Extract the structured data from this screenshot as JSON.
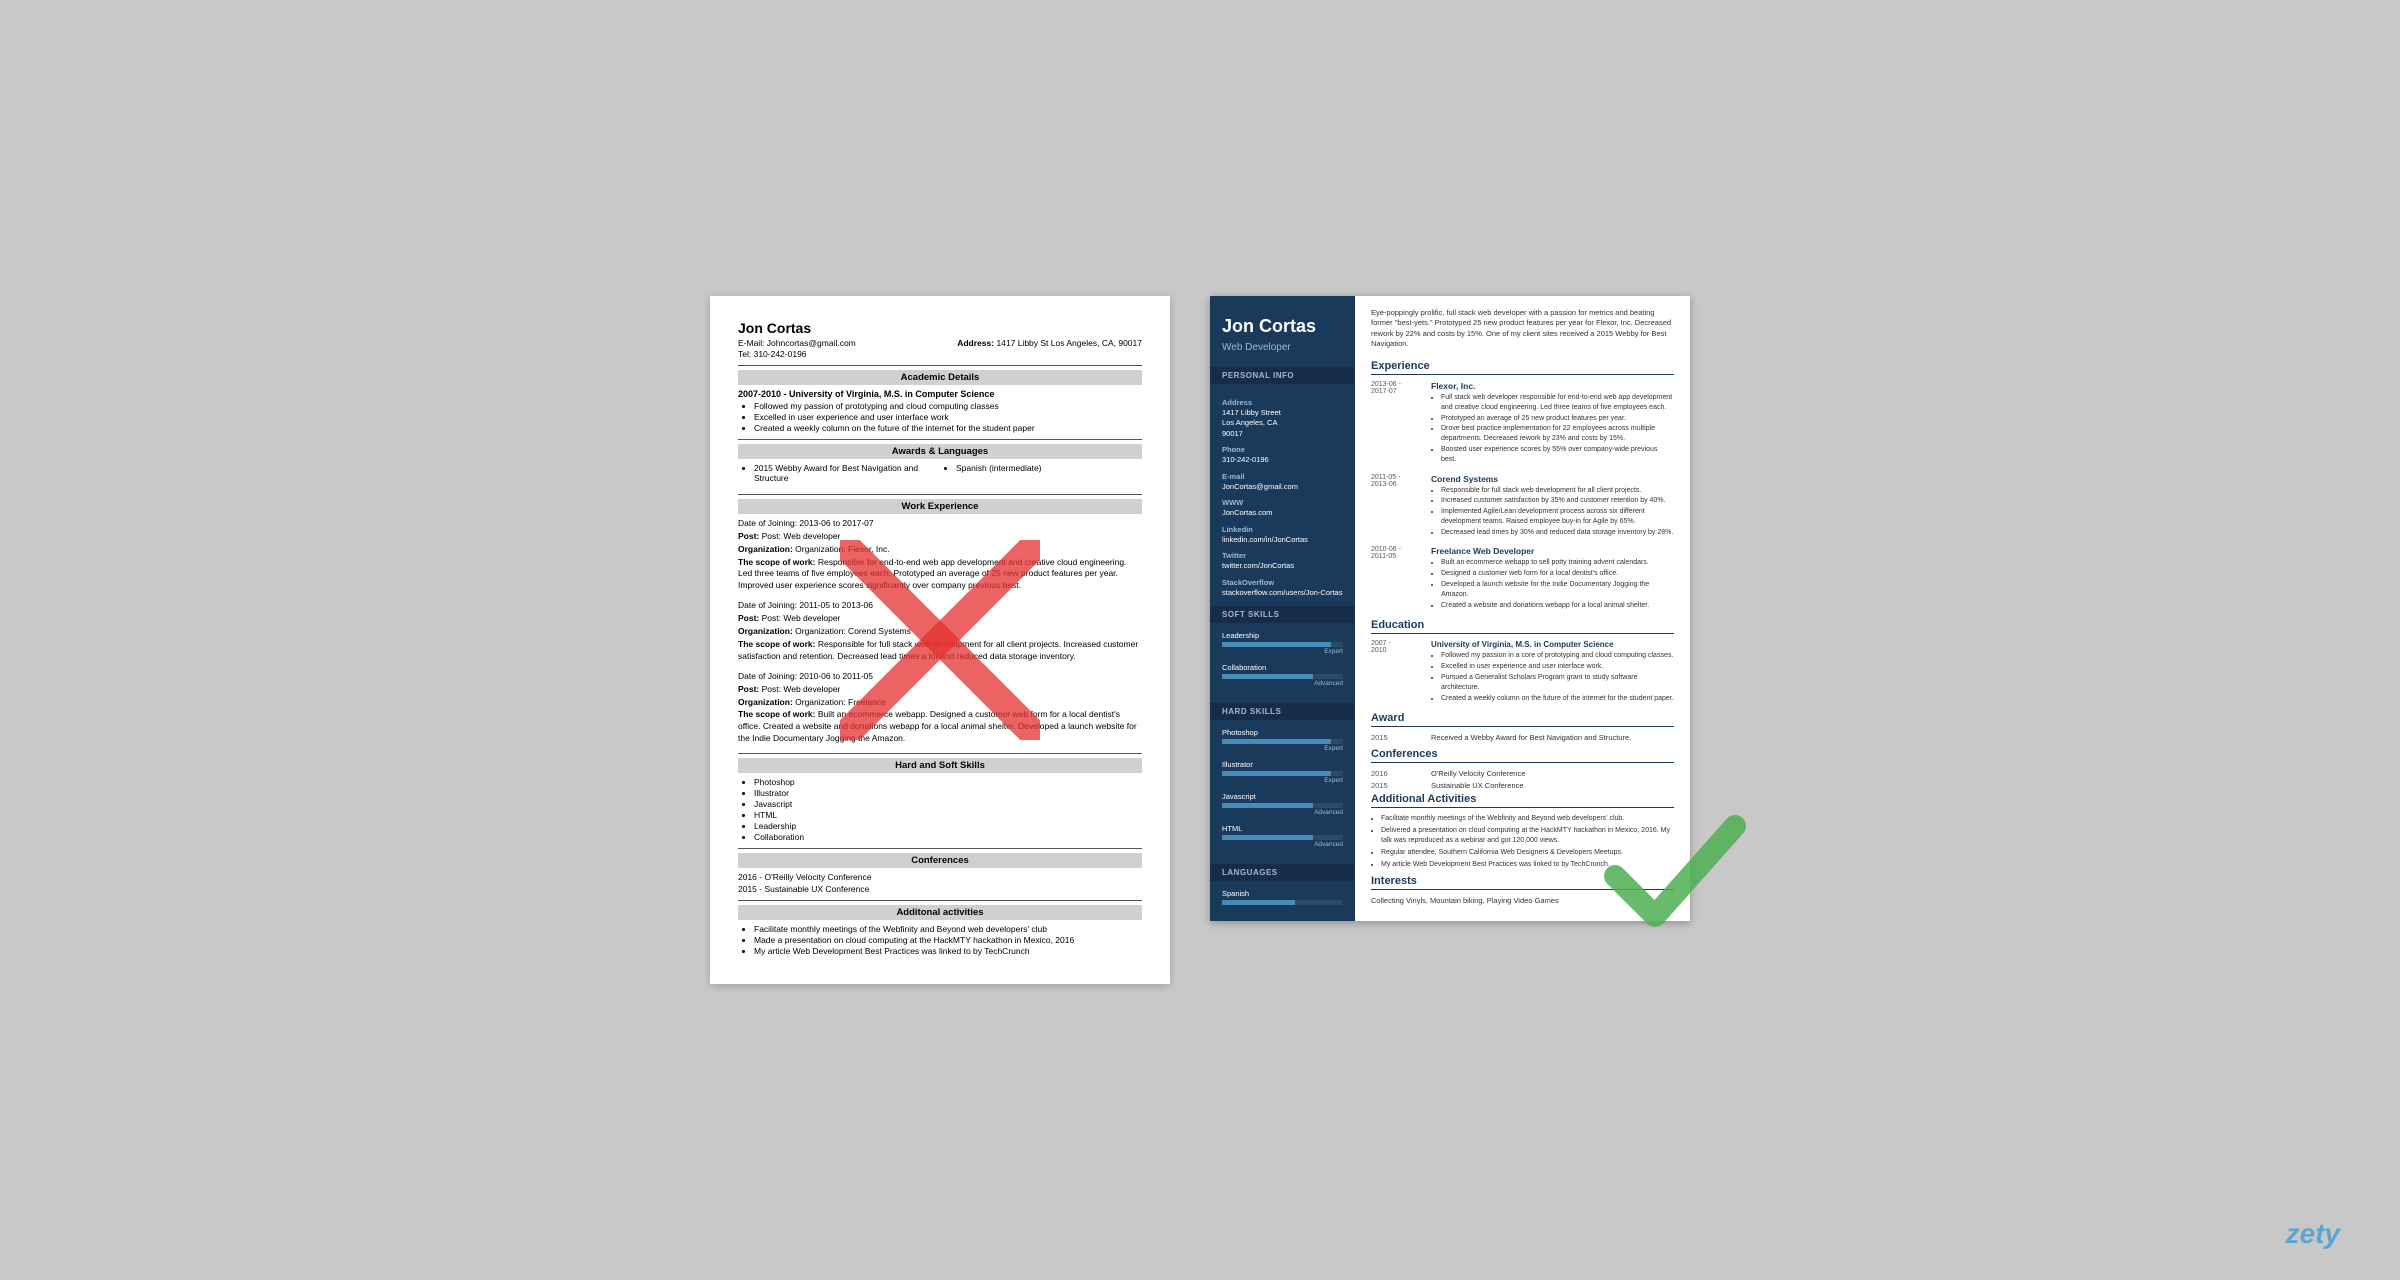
{
  "left_resume": {
    "name": "Jon Cortas",
    "email": "E-Mail: Johncortas@gmail.com",
    "address_label": "Address:",
    "address": "1417 Libby St Los Angeles, CA, 90017",
    "tel": "Tel: 310-242-0196",
    "academic_section": "Academic Details",
    "academic_entry": "2007-2010 - University of Virginia, M.S. in Computer Science",
    "academic_bullets": [
      "Followed my passion of prototyping and cloud computing classes",
      "Excelled in user experience and user interface work",
      "Created a weekly column on the future of the internet for the student paper"
    ],
    "awards_section": "Awards & Languages",
    "award1": "2015 Webby Award for Best Navigation and Structure",
    "language1": "Spanish (intermediate)",
    "work_section": "Work Experience",
    "jobs": [
      {
        "date": "Date of Joining: 2013-06 to 2017-07",
        "post": "Post: Web developer",
        "org": "Organization: Flexor, Inc.",
        "scope_label": "The scope of work:",
        "scope": "Responsible for end-to-end web app development and creative cloud engineering. Led three teams of five employees each. Prototyped an average of 25 new product features per year. Improved user experience scores significantly over company previous best."
      },
      {
        "date": "Date of Joining: 2011-05 to 2013-06",
        "post": "Post: Web developer",
        "org": "Organization: Corend Systems",
        "scope_label": "The scope of work:",
        "scope": "Responsible for full stack web development for all client projects. Increased customer satisfaction and retention. Decreased lead times a lot and reduced data storage inventory."
      },
      {
        "date": "Date of Joining: 2010-06 to 2011-05",
        "post": "Post: Web developer",
        "org": "Organization: Freelance",
        "scope_label": "The scope of work:",
        "scope": "Built an ecommerce webapp. Designed a customer web form for a local dentist's office. Created a website and donations webapp for a local animal shelter. Developed a launch website for the Indie Documentary Jogging the Amazon."
      }
    ],
    "skills_section": "Hard and Soft Skills",
    "skills": [
      "Photoshop",
      "Illustrator",
      "Javascript",
      "HTML",
      "Leadership",
      "Collaboration"
    ],
    "conferences_section": "Conferences",
    "conferences": [
      "2016 - O'Reilly Velocity Conference",
      "2015 - Sustainable UX Conference"
    ],
    "activities_section": "Additonal activities",
    "activities": [
      "Facilitate monthly meetings of the Webfinity and Beyond web developers' club",
      "Made a presentation on cloud computing at the HackMTY hackathon in Mexico, 2016",
      "My article Web Development Best Practices was linked to by TechCrunch"
    ]
  },
  "right_resume": {
    "name": "Jon Cortas",
    "title": "Web Developer",
    "summary": "Eye-poppingly prolific, full stack web developer with a passion for metrics and beating former \"best-yets.\" Prototyped 25 new product features per year for Flexor, Inc. Decreased rework by 22% and costs by 15%. One of my client sites received a 2015 Webby for Best Navigation.",
    "personal_info_label": "Personal Info",
    "address_label": "Address",
    "address": "1417 Libby Street\nLos Angeles, CA\n90017",
    "phone_label": "Phone",
    "phone": "310-242-0196",
    "email_label": "E-mail",
    "email": "JonCortas@gmail.com",
    "www_label": "WWW",
    "www": "JonCortas.com",
    "linkedin_label": "Linkedin",
    "linkedin": "linkedin.com/in/JonCortas",
    "twitter_label": "Twitter",
    "twitter": "twitter.com/JonCortas",
    "stackoverflow_label": "StackOverflow",
    "stackoverflow": "stackoverflow.com/users/Jon-Cortas",
    "soft_skills_label": "Soft Skills",
    "soft_skills": [
      {
        "name": "Leadership",
        "level": 90,
        "label": "Expert"
      },
      {
        "name": "Collaboration",
        "level": 75,
        "label": "Advanced"
      }
    ],
    "hard_skills_label": "Hard Skills",
    "hard_skills": [
      {
        "name": "Photoshop",
        "level": 90,
        "label": "Expert"
      },
      {
        "name": "Illustrator",
        "level": 90,
        "label": "Expert"
      },
      {
        "name": "Javascript",
        "level": 75,
        "label": "Advanced"
      },
      {
        "name": "HTML",
        "level": 75,
        "label": "Advanced"
      }
    ],
    "languages_label": "Languages",
    "languages": [
      {
        "name": "Spanish",
        "level": 60,
        "label": ""
      }
    ],
    "experience_label": "Experience",
    "experience": [
      {
        "date": "2013-06 -\n2017-07",
        "company": "Flexor, Inc.",
        "bullets": [
          "Full stack web developer responsible for end-to-end web app development and creative cloud engineering. Led three teams of five employees each.",
          "Prototyped an average of 25 new product features per year.",
          "Drove best practice implementation for 22 employees across multiple departments. Decreased rework by 23% and costs by 15%.",
          "Boosted user experience scores by 55% over company-wide previous best."
        ]
      },
      {
        "date": "2011-05 -\n2013-06",
        "company": "Corend Systems",
        "bullets": [
          "Responsible for full stack web development for all client projects.",
          "Increased customer satisfaction by 35% and customer retention by 40%.",
          "Implemented Agile/Lean development process across six different development teams. Raised employee buy-in for Agile by 65%.",
          "Decreased lead times by 30% and reduced data storage inventory by 28%."
        ]
      },
      {
        "date": "2010-06 -\n2011-05",
        "company": "Freelance Web Developer",
        "bullets": [
          "Built an ecommerce webapp to sell potty training advent calendars.",
          "Designed a customer web form for a local dentist's office.",
          "Developed a launch website for the Indie Documentary Jogging the Amazon.",
          "Created a website and donations webapp for a local animal shelter."
        ]
      }
    ],
    "education_label": "Education",
    "education": [
      {
        "date": "2007 -\n2010",
        "degree": "University of Virginia, M.S. in Computer Science",
        "bullets": [
          "Followed my passion in a core of prototyping and cloud computing classes.",
          "Excelled in user experience and user interface work.",
          "Pursued a Generalist Scholars Program grant to study software architecture.",
          "Created a weekly column on the future of the internet for the student paper."
        ]
      }
    ],
    "award_label": "Award",
    "award_year": "2015",
    "award_text": "Received a Webby Award for Best Navigation and Structure.",
    "conferences_label": "Conferences",
    "conferences": [
      {
        "year": "2016",
        "name": "O'Reilly Velocity Conference"
      },
      {
        "year": "2015",
        "name": "Sustainable UX Conference"
      }
    ],
    "additional_label": "Additional Activities",
    "additional": [
      "Facilitate monthly meetings of the Webfinity and Beyond web developers' club.",
      "Delivered a presentation on cloud computing at the HackMTY hackathon in Mexico, 2016. My talk was reproduced as a webinar and got 120,000 views.",
      "Regular attendee, Southern California Web Designers & Developers Meetups.",
      "My article Web Development Best Practices was linked to by TechCrunch."
    ],
    "interests_label": "Interests",
    "interests": "Collecting Vinyls, Mountain biking, Playing Video Games"
  },
  "watermark": "zety"
}
